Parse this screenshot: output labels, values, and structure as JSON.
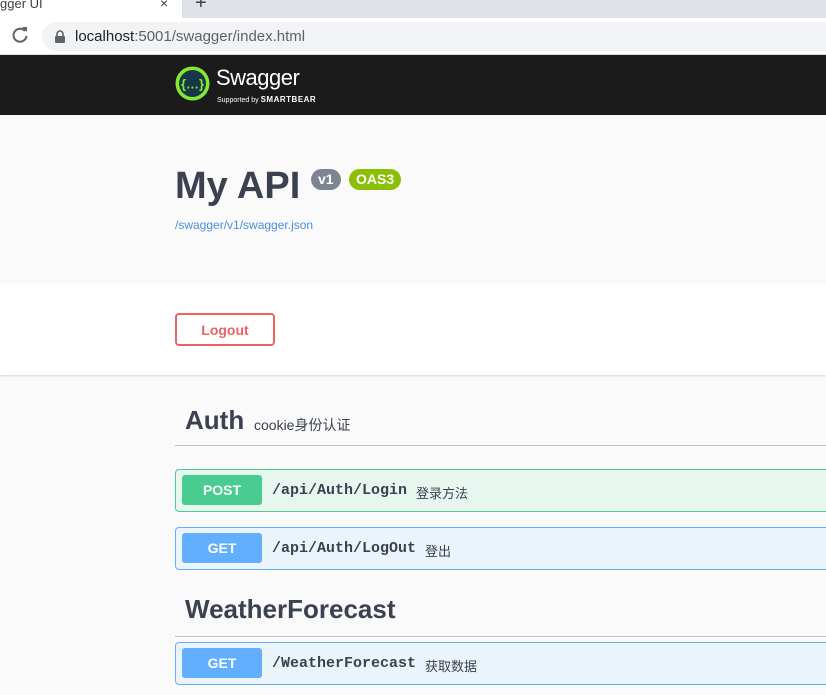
{
  "browser": {
    "tab_title": "gger UI",
    "tab_close": "×",
    "new_tab": "+",
    "url_host": "localhost",
    "url_rest": ":5001/swagger/index.html"
  },
  "topbar": {
    "logo_text": "Swagger",
    "logo_sub_prefix": "Supported by ",
    "logo_sub_brand": "SMARTBEAR"
  },
  "info": {
    "title": "My API",
    "version_badge": "v1",
    "oas_badge": "OAS3",
    "spec_link": "/swagger/v1/swagger.json"
  },
  "auth": {
    "logout_label": "Logout"
  },
  "tags": [
    {
      "name": "Auth",
      "description": "cookie身份认证",
      "operations": [
        {
          "method": "POST",
          "path": "/api/Auth/Login",
          "summary": "登录方法"
        },
        {
          "method": "GET",
          "path": "/api/Auth/LogOut",
          "summary": "登出"
        }
      ]
    },
    {
      "name": "WeatherForecast",
      "description": "",
      "operations": [
        {
          "method": "GET",
          "path": "/WeatherForecast",
          "summary": "获取数据"
        }
      ]
    }
  ],
  "colors": {
    "topbar_bg": "#1b1b1b",
    "logo_green": "#85ea2d",
    "post": "#49cc90",
    "get": "#61affe",
    "logout": "#f06262",
    "oas_badge": "#89bf04"
  }
}
